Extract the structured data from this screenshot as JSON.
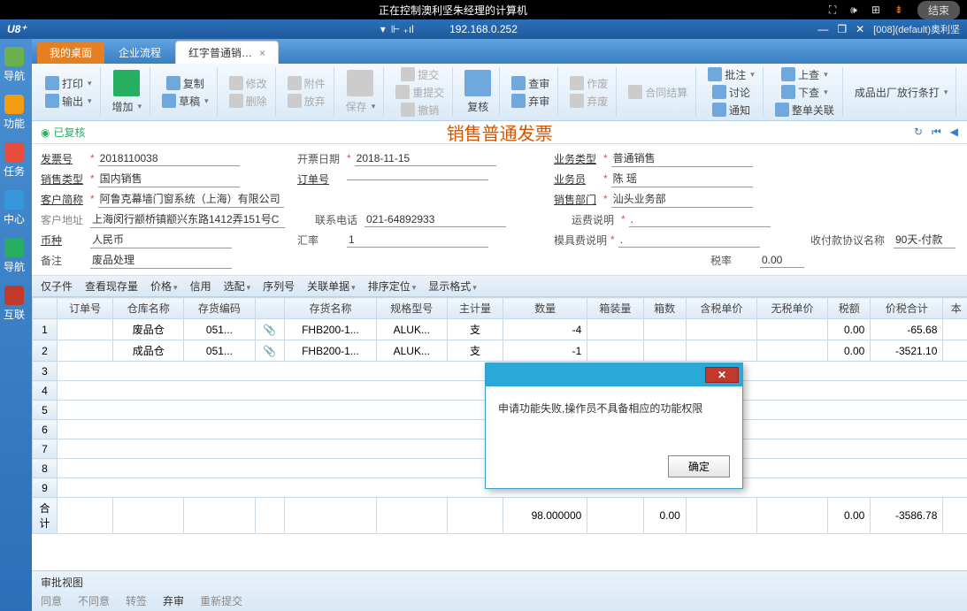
{
  "remote": {
    "msg": "正在控制澳利坚朱经理的计算机",
    "end": "结束"
  },
  "ipbar": {
    "logo": "U8⁺",
    "ip": "192.168.0.252",
    "right": "[008](default)奥利坚"
  },
  "sidebar": [
    "导航",
    "功能",
    "任务",
    "中心",
    "导航",
    "互联"
  ],
  "tabs": {
    "t1": "我的桌面",
    "t2": "企业流程",
    "t3": "红字普通销…"
  },
  "ribbon": {
    "print": "打印",
    "output": "输出",
    "add": "增加",
    "copy": "复制",
    "draft": "草稿",
    "modify": "修改",
    "delete": "删除",
    "attach": "附件",
    "discard": "放弃",
    "save": "保存",
    "submit": "提交",
    "resubmit": "重提交",
    "revoke": "撤销",
    "zsubmit": "复核",
    "review": "查审",
    "abandon": "弃审",
    "workflow": "作废",
    "cwf": "弃废",
    "contract": "合同结算",
    "note": "批注",
    "discuss": "讨论",
    "notify": "通知",
    "up": "上查",
    "down": "下查",
    "related": "整单关联",
    "outstr": "成品出厂放行条打"
  },
  "status": {
    "left": "已复核",
    "title": "销售普通发票"
  },
  "form": {
    "invoice_no_l": "发票号",
    "invoice_no": "2018110038",
    "invoice_date_l": "开票日期",
    "invoice_date": "2018-11-15",
    "biz_type_l": "业务类型",
    "biz_type": "普通销售",
    "sale_type_l": "销售类型",
    "sale_type": "国内销售",
    "order_no_l": "订单号",
    "order_no": "",
    "salesman_l": "业务员",
    "salesman": "陈 瑶",
    "cust_l": "客户简称",
    "cust": "阿鲁克幕墙门窗系统（上海）有限公司",
    "dept_l": "销售部门",
    "dept": "汕头业务部",
    "addr_l": "客户地址",
    "addr": "上海闵行颛桥镇颛兴东路1412弄151号C",
    "tel_l": "联系电话",
    "tel": "021-64892933",
    "freight_l": "运费说明",
    "freight": ".",
    "cur_l": "币种",
    "cur": "人民币",
    "rate_l": "汇率",
    "rate": "1",
    "mold_l": "模具费说明",
    "mold": ".",
    "pay_l": "收付款协议名称",
    "pay": "90天-付款",
    "remark_l": "备注",
    "remark": "废品处理",
    "tax_l": "税率",
    "tax": "0.00"
  },
  "gridtools": {
    "child": "仅子件",
    "stock": "查看现存量",
    "price": "价格",
    "credit": "信用",
    "opt": "选配",
    "serial": "序列号",
    "rel": "关联单据",
    "sort": "排序定位",
    "fmt": "显示格式"
  },
  "cols": {
    "c0": "",
    "c1": "订单号",
    "c2": "仓库名称",
    "c3": "存货编码",
    "c4": "存货名称",
    "c5": "规格型号",
    "c6": "主计量",
    "c7": "数量",
    "c8": "箱装量",
    "c9": "箱数",
    "c10": "含税单价",
    "c11": "无税单价",
    "c12": "税额",
    "c13": "价税合计",
    "c14": "本"
  },
  "rows": [
    {
      "n": "1",
      "wh": "废品仓",
      "code": "051...",
      "name": "FHB200-1...",
      "spec": "ALUK...",
      "uom": "支",
      "qty": "-4",
      "tax": "0.00",
      "total": "-65.68"
    },
    {
      "n": "2",
      "wh": "成品仓",
      "code": "051...",
      "name": "FHB200-1...",
      "spec": "ALUK...",
      "uom": "支",
      "qty": "-1",
      "tax": "0.00",
      "total": "-3521.10"
    }
  ],
  "sum": {
    "label": "合计",
    "qty": "98.000000",
    "box": "0.00",
    "tax": "0.00",
    "total": "-3586.78"
  },
  "footer": {
    "title": "审批视图",
    "agree": "同意",
    "disagree": "不同意",
    "fwd": "转签",
    "reject": "弃审",
    "resubmit": "重新提交"
  },
  "dialog": {
    "msg": "申请功能失败,操作员不具备相应的功能权限",
    "ok": "确定"
  }
}
